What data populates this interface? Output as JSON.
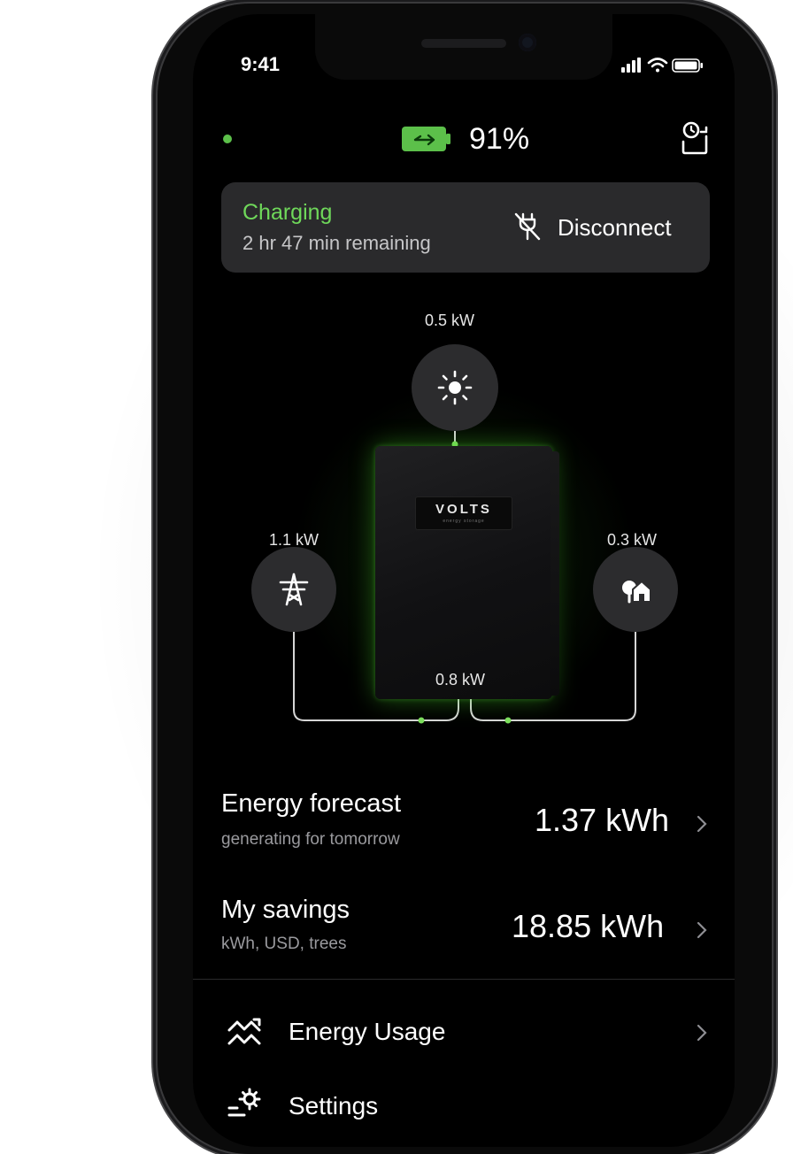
{
  "status_bar": {
    "time": "9:41",
    "icons": [
      "signal-icon",
      "wifi-icon",
      "battery-icon"
    ]
  },
  "header": {
    "online_color": "#5cc04a",
    "battery_percent": "91%",
    "battery_color": "#5cc04a",
    "history_icon": "clock-battery-icon"
  },
  "charging_card": {
    "status": "Charging",
    "status_color": "#6fd85a",
    "remaining": "2 hr 47 min remaining",
    "action_label": "Disconnect",
    "action_icon": "unplug-icon"
  },
  "energy_flow": {
    "brand": "VOLTS",
    "brand_sub": "energy storage",
    "solar": {
      "value": "0.5 kW",
      "icon": "sun-icon"
    },
    "grid": {
      "value": "1.1 kW",
      "icon": "power-tower-icon"
    },
    "home": {
      "value": "0.3 kW",
      "icon": "home-icon"
    },
    "battery": {
      "value": "0.8 kW"
    },
    "line_color": "#d8d8d8",
    "accent_color": "#6fd85a"
  },
  "rows": {
    "forecast": {
      "title": "Energy forecast",
      "subtitle": "generating for tomorrow",
      "value": "1.37 kWh"
    },
    "savings": {
      "title": "My savings",
      "subtitle": "kWh, USD, trees",
      "value": "18.85 kWh"
    }
  },
  "menu": [
    {
      "label": "Energy Usage",
      "icon": "usage-chart-icon"
    },
    {
      "label": "Settings",
      "icon": "settings-gear-icon"
    }
  ]
}
